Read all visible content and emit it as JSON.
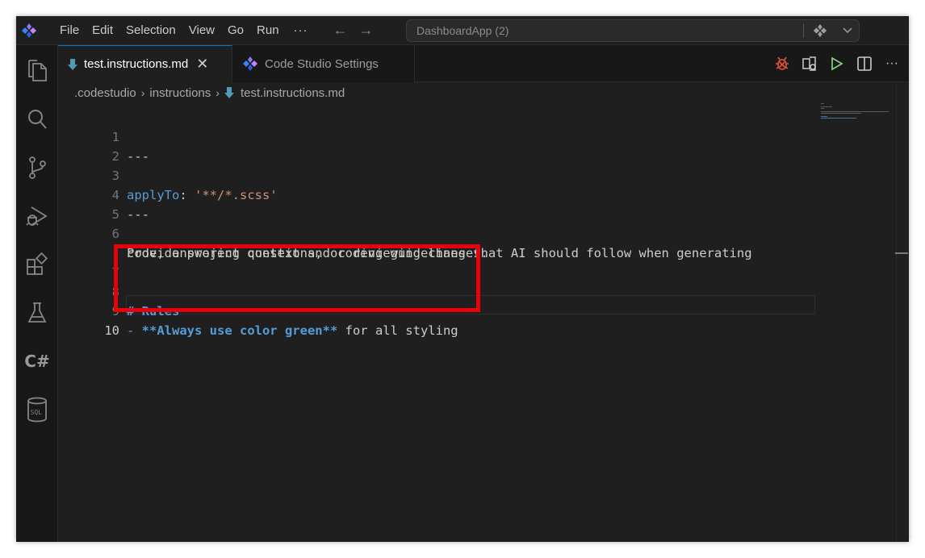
{
  "titlebar": {
    "menu": [
      "File",
      "Edit",
      "Selection",
      "View",
      "Go",
      "Run"
    ],
    "more": "···",
    "back": "←",
    "forward": "→",
    "search_text": "DashboardApp (2)"
  },
  "tabs": [
    {
      "label": "test.instructions.md",
      "close": "✕",
      "icon": "markdown-down-arrow-icon"
    },
    {
      "label": "Code Studio Settings",
      "icon": "code-studio-logo-icon"
    }
  ],
  "editor_actions": [
    "bug-icon",
    "compare-icon",
    "run-icon",
    "split-editor-icon",
    "more-icon"
  ],
  "editor_more": "···",
  "breadcrumb": {
    "parts": [
      ".codestudio",
      "instructions"
    ],
    "file": "test.instructions.md",
    "separator": "›"
  },
  "editor": {
    "line_numbers": [
      "1",
      "2",
      "3",
      "4",
      "5",
      "6",
      "",
      "7",
      "8",
      "9",
      "10"
    ],
    "lines": {
      "l1": "---",
      "l3_key": "applyTo",
      "l3_colon": ": ",
      "l3_value": "'**/*.scss'",
      "l4": "---",
      "l6a": "Provide project context and coding guidelines that AI should follow when generating",
      "l6b": "code, answering questions, or reviewing changes.",
      "l8": "# Rules",
      "l9_bullet": "- ",
      "l9_bold": "**Always use color green**",
      "l9_rest": " for all styling"
    }
  },
  "activitybar": [
    "explorer-icon",
    "search-icon",
    "source-control-icon",
    "run-debug-icon",
    "extensions-icon",
    "testing-icon",
    "csharp-icon",
    "sql-icon"
  ],
  "activity_csharp_label": "C#",
  "colors": {
    "highlight": "#e8000b",
    "accent": "#0078d4",
    "background": "#1f1f1f"
  }
}
